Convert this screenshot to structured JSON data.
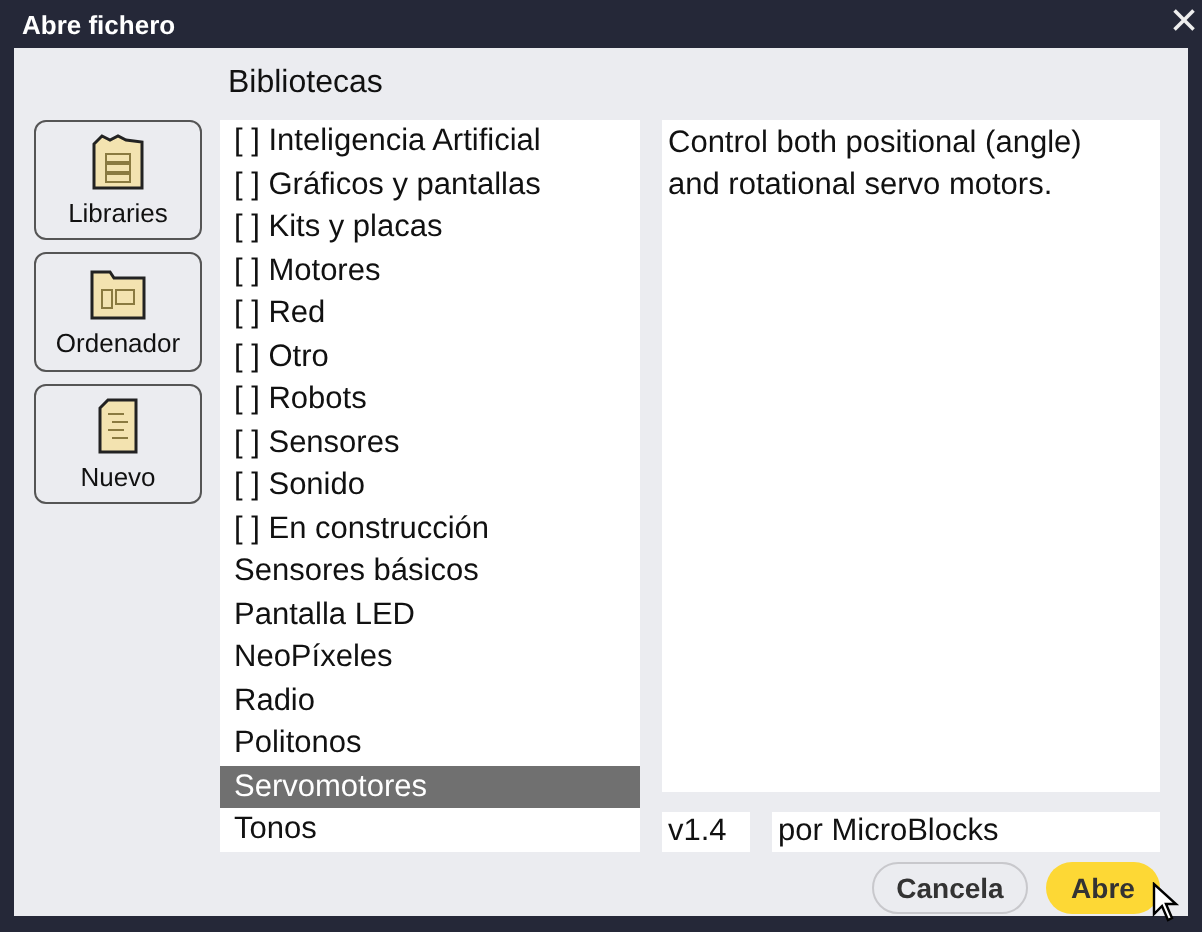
{
  "window": {
    "title": "Abre fichero",
    "close": "×"
  },
  "header": "Bibliotecas",
  "sources": [
    {
      "label": "Libraries",
      "kind": "libraries"
    },
    {
      "label": "Ordenador",
      "kind": "computer"
    },
    {
      "label": "Nuevo",
      "kind": "new"
    }
  ],
  "libraries": [
    {
      "label": "[ ] Inteligencia Artificial",
      "selected": false
    },
    {
      "label": "[ ] Gráficos y pantallas",
      "selected": false
    },
    {
      "label": "[ ] Kits y placas",
      "selected": false
    },
    {
      "label": "[ ] Motores",
      "selected": false
    },
    {
      "label": "[ ] Red",
      "selected": false
    },
    {
      "label": "[ ] Otro",
      "selected": false
    },
    {
      "label": "[ ] Robots",
      "selected": false
    },
    {
      "label": "[ ] Sensores",
      "selected": false
    },
    {
      "label": "[ ] Sonido",
      "selected": false
    },
    {
      "label": "[ ] En construcción",
      "selected": false
    },
    {
      "label": "Sensores básicos",
      "selected": false
    },
    {
      "label": "Pantalla LED",
      "selected": false
    },
    {
      "label": "NeoPíxeles",
      "selected": false
    },
    {
      "label": "Radio",
      "selected": false
    },
    {
      "label": "Politonos",
      "selected": false
    },
    {
      "label": "Servomotores",
      "selected": true
    },
    {
      "label": "Tonos",
      "selected": false
    }
  ],
  "description": "Control both positional (angle) and rotational servo motors.",
  "version": "v1.4",
  "author": "por MicroBlocks",
  "buttons": [
    {
      "label": "Cancela",
      "kind": "secondary"
    },
    {
      "label": "Abre",
      "kind": "primary"
    }
  ]
}
